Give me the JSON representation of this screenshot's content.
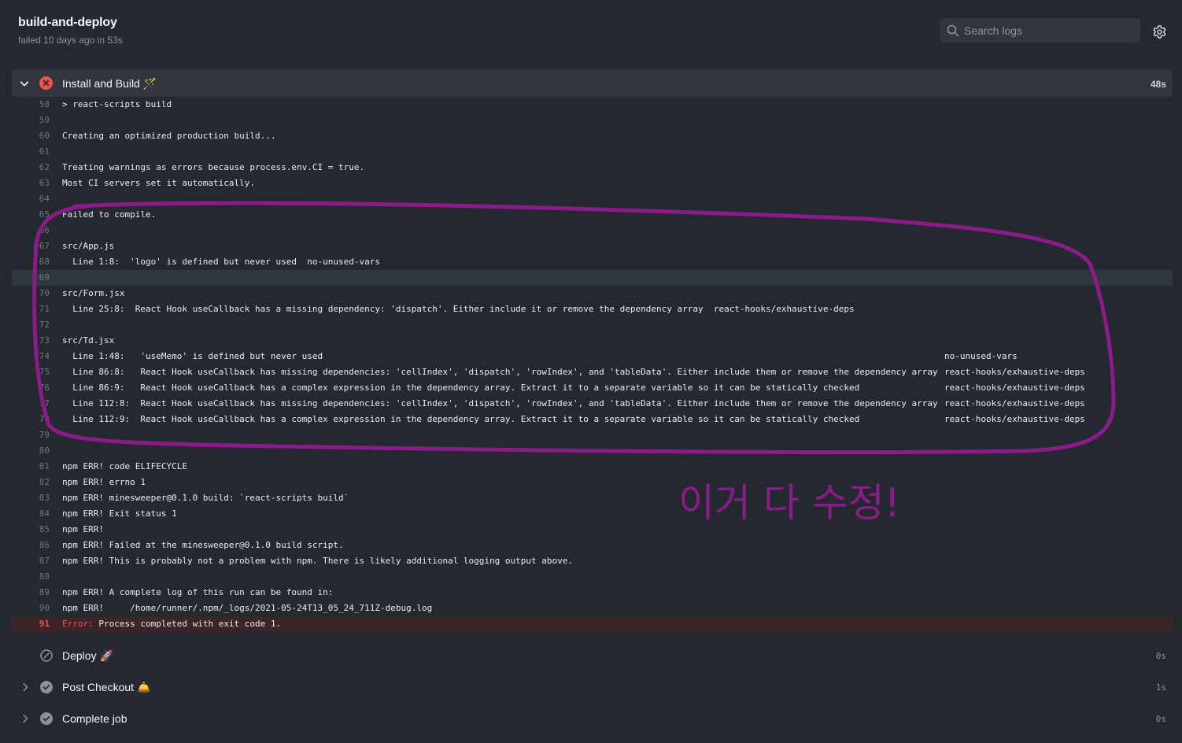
{
  "header": {
    "job_title": "build-and-deploy",
    "job_status": "failed 10 days ago in 53s"
  },
  "search": {
    "placeholder": "Search logs",
    "value": ""
  },
  "active_step": {
    "title": "Install and Build 🪄",
    "duration": "48s"
  },
  "log_lines": [
    {
      "n": "58",
      "t": "> react-scripts build"
    },
    {
      "n": "59",
      "t": ""
    },
    {
      "n": "60",
      "t": "Creating an optimized production build..."
    },
    {
      "n": "61",
      "t": ""
    },
    {
      "n": "62",
      "t": "Treating warnings as errors because process.env.CI = true."
    },
    {
      "n": "63",
      "t": "Most CI servers set it automatically."
    },
    {
      "n": "64",
      "t": ""
    },
    {
      "n": "65",
      "t": "Failed to compile."
    },
    {
      "n": "66",
      "t": ""
    },
    {
      "n": "67",
      "t": "src/App.js"
    },
    {
      "n": "68",
      "t": "  Line 1:8:  'logo' is defined but never used  no-unused-vars"
    },
    {
      "n": "69",
      "t": ""
    },
    {
      "n": "70",
      "t": "src/Form.jsx"
    },
    {
      "n": "71",
      "t": "  Line 25:8:  React Hook useCallback has a missing dependency: 'dispatch'. Either include it or remove the dependency array  react-hooks/exhaustive-deps"
    },
    {
      "n": "72",
      "t": ""
    },
    {
      "n": "73",
      "t": "src/Td.jsx"
    },
    {
      "n": "74",
      "t": "  Line 1:48:   'useMemo' is defined but never used",
      "rule": "no-unused-vars"
    },
    {
      "n": "75",
      "t": "  Line 86:8:   React Hook useCallback has missing dependencies: 'cellIndex', 'dispatch', 'rowIndex', and 'tableData'. Either include them or remove the dependency array",
      "rule": "react-hooks/exhaustive-deps"
    },
    {
      "n": "76",
      "t": "  Line 86:9:   React Hook useCallback has a complex expression in the dependency array. Extract it to a separate variable so it can be statically checked",
      "rule": "react-hooks/exhaustive-deps"
    },
    {
      "n": "77",
      "t": "  Line 112:8:  React Hook useCallback has missing dependencies: 'cellIndex', 'dispatch', 'rowIndex', and 'tableData'. Either include them or remove the dependency array",
      "rule": "react-hooks/exhaustive-deps"
    },
    {
      "n": "78",
      "t": "  Line 112:9:  React Hook useCallback has a complex expression in the dependency array. Extract it to a separate variable so it can be statically checked",
      "rule": "react-hooks/exhaustive-deps"
    },
    {
      "n": "79",
      "t": ""
    },
    {
      "n": "80",
      "t": ""
    },
    {
      "n": "81",
      "t": "npm ERR! code ELIFECYCLE"
    },
    {
      "n": "82",
      "t": "npm ERR! errno 1"
    },
    {
      "n": "83",
      "t": "npm ERR! minesweeper@0.1.0 build: `react-scripts build`"
    },
    {
      "n": "84",
      "t": "npm ERR! Exit status 1"
    },
    {
      "n": "85",
      "t": "npm ERR!"
    },
    {
      "n": "86",
      "t": "npm ERR! Failed at the minesweeper@0.1.0 build script."
    },
    {
      "n": "87",
      "t": "npm ERR! This is probably not a problem with npm. There is likely additional logging output above."
    },
    {
      "n": "88",
      "t": ""
    },
    {
      "n": "89",
      "t": "npm ERR! A complete log of this run can be found in:"
    },
    {
      "n": "90",
      "t": "npm ERR!     /home/runner/.npm/_logs/2021-05-24T13_05_24_711Z-debug.log"
    },
    {
      "n": "91",
      "t": " Process completed with exit code 1.",
      "prefix": "Error:"
    }
  ],
  "other_steps": [
    {
      "title": "Deploy 🚀",
      "duration": "0s",
      "status": "skipped",
      "expandable": false
    },
    {
      "title": "Post Checkout 🛎️",
      "duration": "1s",
      "status": "success",
      "expandable": true
    },
    {
      "title": "Complete job",
      "duration": "0s",
      "status": "success",
      "expandable": true
    }
  ],
  "annotation": {
    "handwritten_text": "이거 다 수정!",
    "color": "#8b1a8b"
  },
  "colors": {
    "background": "#24292f",
    "error": "#f85149",
    "success": "#8b949e"
  }
}
